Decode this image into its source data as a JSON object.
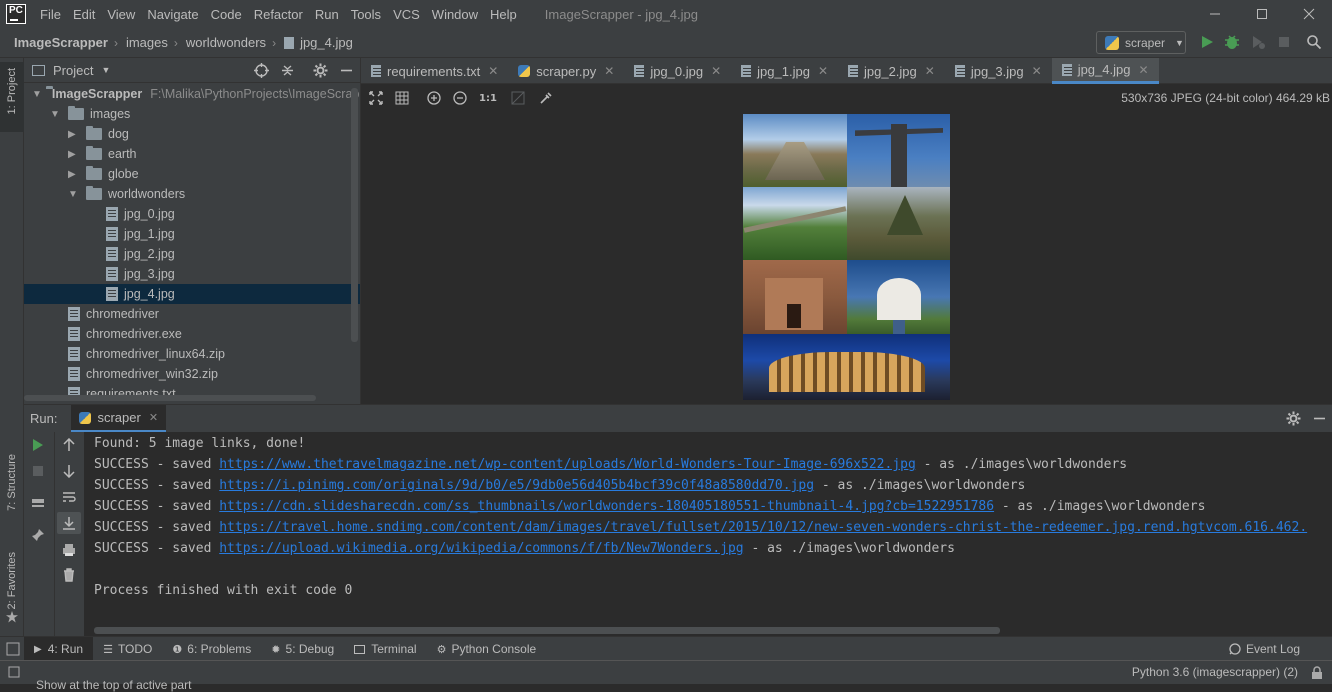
{
  "window": {
    "title": "ImageScrapper - jpg_4.jpg",
    "menu": [
      "File",
      "Edit",
      "View",
      "Navigate",
      "Code",
      "Refactor",
      "Run",
      "Tools",
      "VCS",
      "Window",
      "Help"
    ]
  },
  "breadcrumb": {
    "project": "ImageScrapper",
    "items": [
      "images",
      "worldwonders",
      "jpg_4.jpg"
    ]
  },
  "run_config": {
    "label": "scraper"
  },
  "project_panel": {
    "title": "Project",
    "root_name": "ImageScrapper",
    "root_path": "F:\\Malika\\PythonProjects\\ImageScrap",
    "tree": {
      "images": "images",
      "dog": "dog",
      "earth": "earth",
      "globe": "globe",
      "worldwonders": "worldwonders",
      "files": [
        "jpg_0.jpg",
        "jpg_1.jpg",
        "jpg_2.jpg",
        "jpg_3.jpg",
        "jpg_4.jpg"
      ],
      "root_files": [
        "chromedriver",
        "chromedriver.exe",
        "chromedriver_linux64.zip",
        "chromedriver_win32.zip",
        "requirements.txt"
      ]
    }
  },
  "left_strip": {
    "project_tab": "1: Project",
    "structure_tab": "7: Structure",
    "favorites_tab": "2: Favorites"
  },
  "editor_tabs": [
    "requirements.txt",
    "scraper.py",
    "jpg_0.jpg",
    "jpg_1.jpg",
    "jpg_2.jpg",
    "jpg_3.jpg",
    "jpg_4.jpg"
  ],
  "image_viewer": {
    "zoom_label": "1:1",
    "info": "530x736 JPEG (24-bit color) 464.29 kB"
  },
  "run_panel": {
    "label": "Run:",
    "tab": "scraper"
  },
  "console": {
    "found": "Found: 5 image links, done!",
    "prefix": "SUCCESS - saved ",
    "suffix": " - as ./images\\worldwonders",
    "links": [
      "https://www.thetravelmagazine.net/wp-content/uploads/World-Wonders-Tour-Image-696x522.jpg",
      "https://i.pinimg.com/originals/9d/b0/e5/9db0e56d405b4bcf39c0f48a8580dd70.jpg",
      "https://cdn.slidesharecdn.com/ss_thumbnails/worldwonders-180405180551-thumbnail-4.jpg?cb=1522951786",
      "https://travel.home.sndimg.com/content/dam/images/travel/fullset/2015/10/12/new-seven-wonders-christ-the-redeemer.jpg.rend.hgtvcom.616.462.",
      "https://upload.wikimedia.org/wikipedia/commons/f/fb/New7Wonders.jpg"
    ],
    "suffix_4": " - as ./images\\worldwonders",
    "exit": "Process finished with exit code 0"
  },
  "bottom_tabs": {
    "run": "4: Run",
    "todo": "TODO",
    "problems": "6: Problems",
    "debug": "5: Debug",
    "terminal": "Terminal",
    "python_console": "Python Console",
    "event_log": "Event Log"
  },
  "status": {
    "interpreter": "Python 3.6 (imagescrapper) (2)",
    "hint": "Show at the top of active part"
  },
  "colors": {
    "accent": "#4a88c7",
    "link": "#287bde",
    "run_green": "#499c54"
  }
}
